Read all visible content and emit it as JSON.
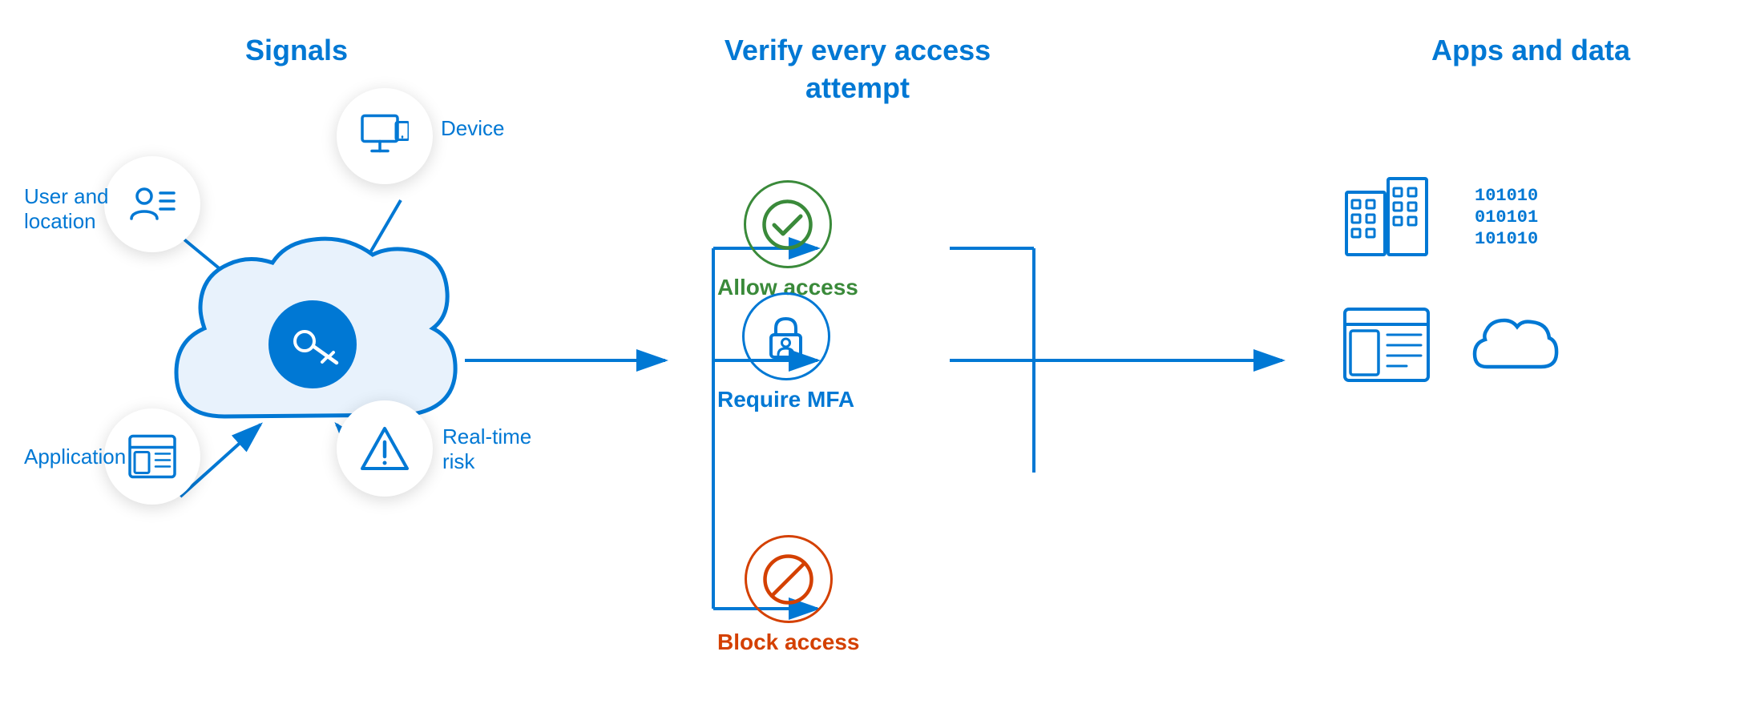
{
  "sections": {
    "signals": {
      "title": "Signals",
      "signals": [
        {
          "id": "user-location",
          "label": "User and\nlocation",
          "icon": "user-list"
        },
        {
          "id": "device",
          "label": "Device",
          "icon": "monitor"
        },
        {
          "id": "application",
          "label": "Application",
          "icon": "app"
        },
        {
          "id": "realtime-risk",
          "label": "Real-time\nrisk",
          "icon": "warning"
        }
      ]
    },
    "verify": {
      "title": "Verify every access\nattempt",
      "outcomes": [
        {
          "id": "allow",
          "label": "Allow access",
          "icon": "checkmark",
          "color": "#3a8a3a"
        },
        {
          "id": "mfa",
          "label": "Require MFA",
          "icon": "lock-person",
          "color": "#0078d4"
        },
        {
          "id": "block",
          "label": "Block access",
          "icon": "block",
          "color": "#d44000"
        }
      ]
    },
    "apps": {
      "title": "Apps and data",
      "items": [
        {
          "id": "buildings",
          "icon": "buildings"
        },
        {
          "id": "binary",
          "icon": "binary"
        },
        {
          "id": "layout",
          "icon": "layout"
        },
        {
          "id": "cloud",
          "icon": "cloud-small"
        }
      ]
    }
  },
  "colors": {
    "blue": "#0078d4",
    "green": "#3a8a3a",
    "orange": "#d44000",
    "white": "#ffffff",
    "lightShadow": "rgba(0,0,0,0.12)"
  }
}
